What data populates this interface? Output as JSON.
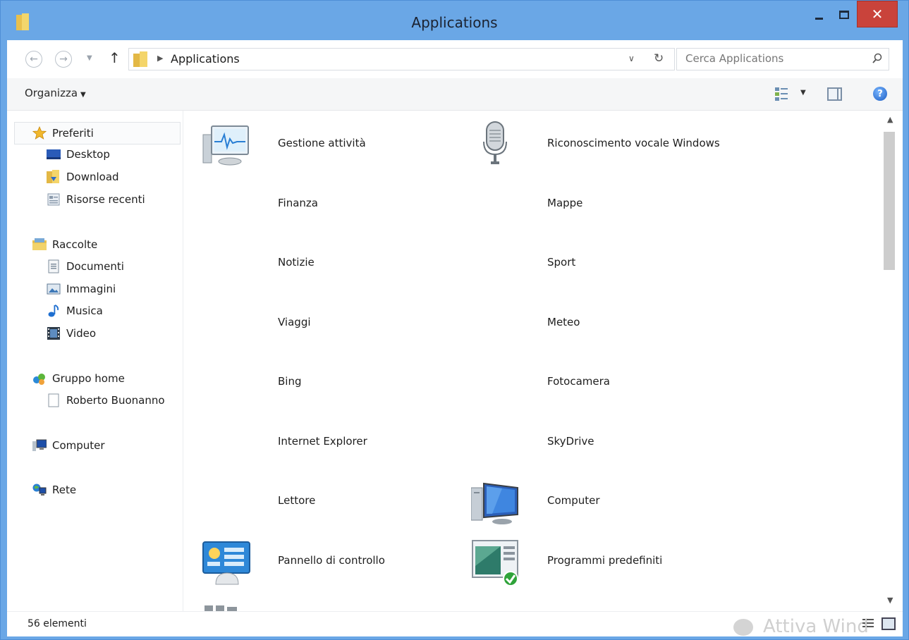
{
  "window": {
    "title": "Applications",
    "close_glyph": "✕"
  },
  "address": {
    "path_label": "Applications",
    "search_placeholder": "Cerca Applications"
  },
  "toolbar": {
    "organize_label": "Organizza"
  },
  "navigation": {
    "favorites": {
      "label": "Preferiti",
      "items": [
        "Desktop",
        "Download",
        "Risorse recenti"
      ]
    },
    "libraries": {
      "label": "Raccolte",
      "items": [
        "Documenti",
        "Immagini",
        "Musica",
        "Video"
      ]
    },
    "homegroup": {
      "label": "Gruppo home",
      "items": [
        "Roberto Buonanno"
      ]
    },
    "computer": {
      "label": "Computer"
    },
    "network": {
      "label": "Rete"
    }
  },
  "apps": [
    {
      "name": "Gestione attività",
      "icon": "task-manager-icon"
    },
    {
      "name": "Riconoscimento vocale Windows",
      "icon": "microphone-icon"
    },
    {
      "name": "Finanza",
      "icon": ""
    },
    {
      "name": "Mappe",
      "icon": ""
    },
    {
      "name": "Notizie",
      "icon": ""
    },
    {
      "name": "Sport",
      "icon": ""
    },
    {
      "name": "Viaggi",
      "icon": ""
    },
    {
      "name": "Meteo",
      "icon": ""
    },
    {
      "name": "Bing",
      "icon": ""
    },
    {
      "name": "Fotocamera",
      "icon": ""
    },
    {
      "name": "Internet Explorer",
      "icon": ""
    },
    {
      "name": "SkyDrive",
      "icon": ""
    },
    {
      "name": "Lettore",
      "icon": ""
    },
    {
      "name": "Computer",
      "icon": "computer-icon"
    },
    {
      "name": "Pannello di controllo",
      "icon": "control-panel-icon"
    },
    {
      "name": "Programmi predefiniti",
      "icon": "default-programs-icon"
    }
  ],
  "status": {
    "item_count": "56 elementi",
    "watermark": "Attiva Wind"
  }
}
